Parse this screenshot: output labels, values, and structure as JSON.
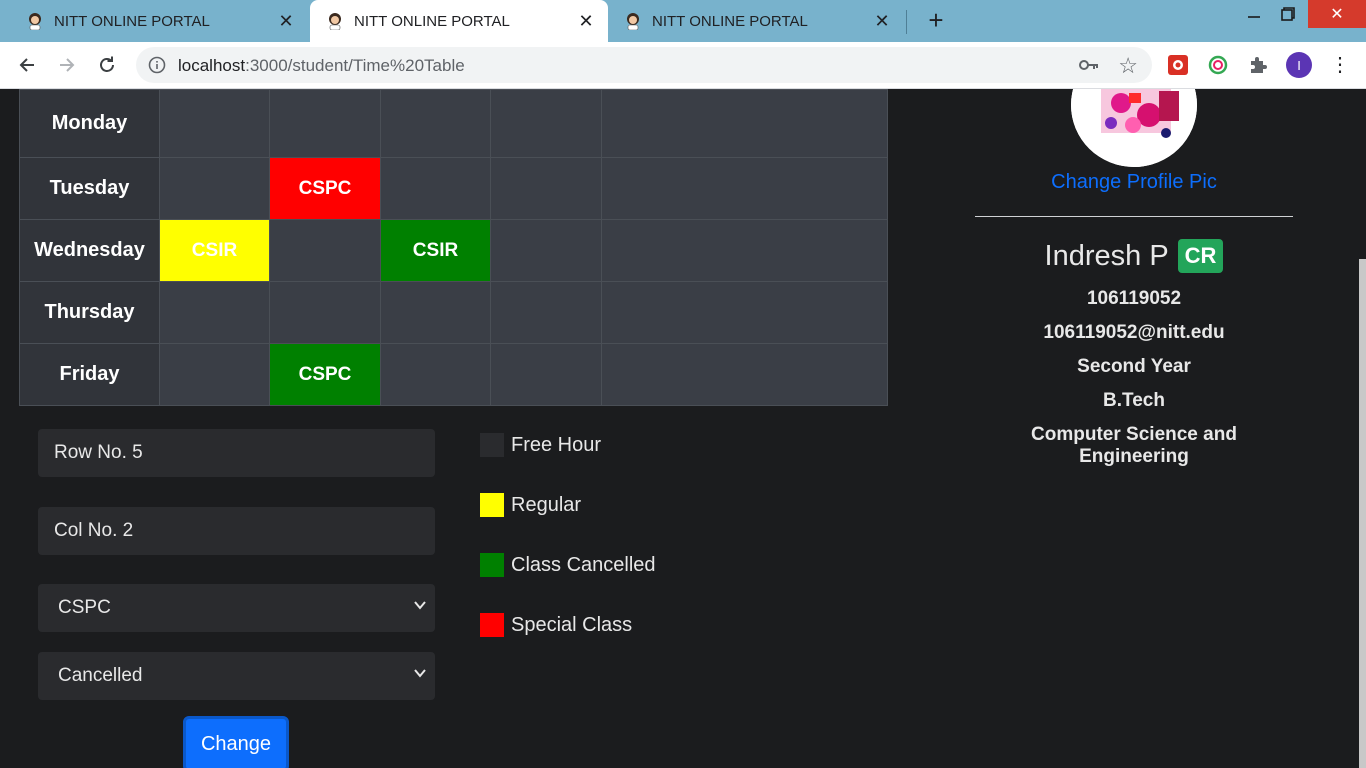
{
  "browser": {
    "tabs": [
      {
        "title": "NITT ONLINE PORTAL",
        "active": false
      },
      {
        "title": "NITT ONLINE PORTAL",
        "active": true
      },
      {
        "title": "NITT ONLINE PORTAL",
        "active": false
      }
    ],
    "url_host": "localhost",
    "url_rest": ":3000/student/Time%20Table"
  },
  "timetable": {
    "rows": [
      {
        "day": "Monday",
        "cells": [
          "",
          "",
          "",
          "",
          ""
        ]
      },
      {
        "day": "Tuesday",
        "cells": [
          "",
          "CSPC",
          "",
          "",
          ""
        ]
      },
      {
        "day": "Wednesday",
        "cells": [
          "CSIR",
          "",
          "CSIR",
          "",
          ""
        ]
      },
      {
        "day": "Thursday",
        "cells": [
          "",
          "",
          "",
          "",
          ""
        ]
      },
      {
        "day": "Friday",
        "cells": [
          "",
          "CSPC",
          "",
          "",
          ""
        ]
      }
    ],
    "colors": {
      "free": "#3a3e46",
      "regular": "#ffff00",
      "cancelled": "#008000",
      "special": "#ff0000"
    }
  },
  "form": {
    "row_value": "Row No. 5",
    "col_value": "Col No. 2",
    "subject_selected": "CSPC",
    "status_selected": "Cancelled",
    "change_label": "Change"
  },
  "legend": {
    "free": "Free Hour",
    "regular": "Regular",
    "cancelled": "Class Cancelled",
    "special": "Special Class"
  },
  "profile": {
    "change_pic": "Change Profile Pic",
    "name": "Indresh P",
    "badge": "CR",
    "roll": "106119052",
    "email": "106119052@nitt.edu",
    "year": "Second Year",
    "degree": "B.Tech",
    "dept": "Computer Science and Engineering"
  },
  "toolbar": {
    "avatar_letter": "I"
  }
}
